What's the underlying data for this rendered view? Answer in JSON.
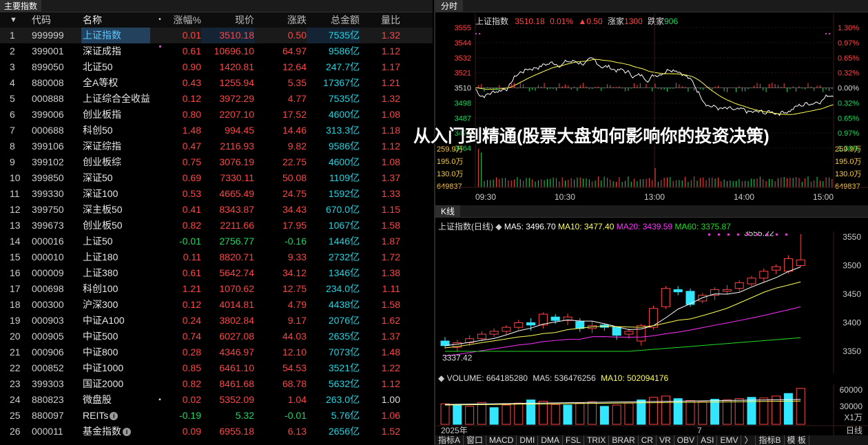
{
  "left": {
    "tab_label": "主要指数",
    "headers": {
      "code": "代码",
      "name": "名称",
      "dot": "•",
      "pct": "涨幅%",
      "price": "现价",
      "chg": "涨跌",
      "amount": "总金额",
      "vr": "量比"
    },
    "rows": [
      {
        "seq": "1",
        "code": "999999",
        "name": "上证指数",
        "pct": "0.01",
        "price": "3510.18",
        "chg": "0.50",
        "amt": "7535亿",
        "vr": "1.32",
        "dir": "up"
      },
      {
        "seq": "2",
        "code": "399001",
        "name": "深证成指",
        "pct": "0.61",
        "price": "10696.10",
        "chg": "64.97",
        "amt": "9586亿",
        "vr": "1.12",
        "dir": "up"
      },
      {
        "seq": "3",
        "code": "899050",
        "name": "北证50",
        "pct": "0.90",
        "price": "1420.81",
        "chg": "12.64",
        "amt": "247.7亿",
        "vr": "1.17",
        "dir": "up"
      },
      {
        "seq": "4",
        "code": "880008",
        "name": "全A等权",
        "pct": "0.43",
        "price": "1255.94",
        "chg": "5.35",
        "amt": "17367亿",
        "vr": "1.21",
        "dir": "up"
      },
      {
        "seq": "5",
        "code": "000888",
        "name": "上证综合全收益",
        "pct": "0.12",
        "price": "3972.29",
        "chg": "4.77",
        "amt": "7535亿",
        "vr": "1.32",
        "dir": "up"
      },
      {
        "seq": "6",
        "code": "399006",
        "name": "创业板指",
        "pct": "0.80",
        "price": "2207.10",
        "chg": "17.52",
        "amt": "4600亿",
        "vr": "1.08",
        "dir": "up"
      },
      {
        "seq": "7",
        "code": "000688",
        "name": "科创50",
        "pct": "1.48",
        "price": "994.45",
        "chg": "14.46",
        "amt": "313.3亿",
        "vr": "1.18",
        "dir": "up"
      },
      {
        "seq": "8",
        "code": "399106",
        "name": "深证综指",
        "pct": "0.47",
        "price": "2116.93",
        "chg": "9.82",
        "amt": "9586亿",
        "vr": "1.12",
        "dir": "up"
      },
      {
        "seq": "9",
        "code": "399102",
        "name": "创业板综",
        "pct": "0.75",
        "price": "3076.19",
        "chg": "22.75",
        "amt": "4600亿",
        "vr": "1.08",
        "dir": "up"
      },
      {
        "seq": "10",
        "code": "399850",
        "name": "深证50",
        "pct": "0.69",
        "price": "7330.11",
        "chg": "50.08",
        "amt": "1109亿",
        "vr": "1.37",
        "dir": "up"
      },
      {
        "seq": "11",
        "code": "399330",
        "name": "深证100",
        "pct": "0.53",
        "price": "4665.49",
        "chg": "24.75",
        "amt": "1592亿",
        "vr": "1.33",
        "dir": "up"
      },
      {
        "seq": "12",
        "code": "399750",
        "name": "深主板50",
        "pct": "0.41",
        "price": "8343.87",
        "chg": "34.43",
        "amt": "670.0亿",
        "vr": "1.15",
        "dir": "up"
      },
      {
        "seq": "13",
        "code": "399673",
        "name": "创业板50",
        "pct": "0.82",
        "price": "2211.66",
        "chg": "17.95",
        "amt": "1067亿",
        "vr": "1.58",
        "dir": "up"
      },
      {
        "seq": "14",
        "code": "000016",
        "name": "上证50",
        "pct": "-0.01",
        "price": "2756.77",
        "chg": "-0.16",
        "amt": "1446亿",
        "vr": "1.87",
        "dir": "dn"
      },
      {
        "seq": "15",
        "code": "000010",
        "name": "上证180",
        "pct": "0.11",
        "price": "8820.71",
        "chg": "9.33",
        "amt": "2732亿",
        "vr": "1.72",
        "dir": "up"
      },
      {
        "seq": "16",
        "code": "000009",
        "name": "上证380",
        "pct": "0.61",
        "price": "5642.74",
        "chg": "34.12",
        "amt": "1346亿",
        "vr": "1.38",
        "dir": "up"
      },
      {
        "seq": "17",
        "code": "000698",
        "name": "科创100",
        "pct": "1.21",
        "price": "1070.62",
        "chg": "12.75",
        "amt": "234.0亿",
        "vr": "1.11",
        "dir": "up"
      },
      {
        "seq": "18",
        "code": "000300",
        "name": "沪深300",
        "pct": "0.12",
        "price": "4014.81",
        "chg": "4.79",
        "amt": "4438亿",
        "vr": "1.58",
        "dir": "up"
      },
      {
        "seq": "19",
        "code": "000903",
        "name": "中证A100",
        "pct": "0.24",
        "price": "3802.84",
        "chg": "9.17",
        "amt": "2076亿",
        "vr": "1.62",
        "dir": "up"
      },
      {
        "seq": "20",
        "code": "000905",
        "name": "中证500",
        "pct": "0.74",
        "price": "6027.08",
        "chg": "44.03",
        "amt": "2635亿",
        "vr": "1.37",
        "dir": "up"
      },
      {
        "seq": "21",
        "code": "000906",
        "name": "中证800",
        "pct": "0.28",
        "price": "4346.97",
        "chg": "12.10",
        "amt": "7073亿",
        "vr": "1.48",
        "dir": "up"
      },
      {
        "seq": "22",
        "code": "000852",
        "name": "中证1000",
        "pct": "0.85",
        "price": "6461.10",
        "chg": "54.53",
        "amt": "3521亿",
        "vr": "1.22",
        "dir": "up"
      },
      {
        "seq": "23",
        "code": "399303",
        "name": "国证2000",
        "pct": "0.82",
        "price": "8461.68",
        "chg": "68.78",
        "amt": "5632亿",
        "vr": "1.12",
        "dir": "up"
      },
      {
        "seq": "24",
        "code": "880823",
        "name": "微盘股",
        "pct": "0.02",
        "price": "5352.09",
        "chg": "1.04",
        "amt": "263.0亿",
        "vr": "1.00",
        "dir": "up"
      },
      {
        "seq": "25",
        "code": "880097",
        "name": "REITs",
        "pct": "-0.19",
        "price": "5.32",
        "chg": "-0.01",
        "amt": "5.76亿",
        "vr": "1.06",
        "dir": "dn"
      },
      {
        "seq": "26",
        "code": "000011",
        "name": "基金指数",
        "pct": "0.09",
        "price": "6955.18",
        "chg": "6.13",
        "amt": "2656亿",
        "vr": "1.52",
        "dir": "up"
      }
    ]
  },
  "overlay_title": "从入门到精通(股票大盘如何影响你的投资决策)",
  "intraday": {
    "tab_label": "分时",
    "index_name": "上证指数",
    "price": "3510.18",
    "pct": "0.01%",
    "change": "▲0.50",
    "up_label": "涨家",
    "up_count": "1300",
    "down_label": "跌家",
    "down_count": "906",
    "price_axis": [
      "3555",
      "3544",
      "3532",
      "3521",
      "3510",
      "3498",
      "3487",
      "3476",
      "3464"
    ],
    "pct_axis": [
      "1.30%",
      "0.97%",
      "0.65%",
      "0.32%",
      "0.00%",
      "0.32%",
      "0.65%",
      "0.97%",
      "1.30%"
    ],
    "vol_axis_left": [
      "259.9万",
      "195.0万",
      "130.0万",
      "649837"
    ],
    "vol_axis_right": [
      "259.9万",
      "195.0万",
      "130.0万",
      "649837"
    ],
    "time_axis": [
      "09:30",
      "10:30",
      "13:00",
      "14:00",
      "15:00"
    ]
  },
  "kline": {
    "tab_label": "K线",
    "title": "上证指数(日线)",
    "ma5_label": "MA5: 3496.70",
    "ma10_label": "MA10: 3477.40",
    "ma20_label": "MA20: 3439.59",
    "ma60_label": "MA60: 3375.87",
    "price_axis": [
      "3550",
      "3500",
      "3450",
      "3400",
      "3350"
    ],
    "high_label": "3555.22",
    "low_label": "3337.42",
    "volume_label": "VOLUME: 664185280",
    "vol_ma5_label": "MA5: 536476256",
    "vol_ma10_label": "MA10: 502094176",
    "vol_axis": [
      "60000",
      "30000",
      "X1万"
    ],
    "date_left": "2025年",
    "date_mid": "7",
    "period": "日线"
  },
  "bottom_tabs": [
    "指标A",
    "窗口",
    "MACD",
    "DMI",
    "DMA",
    "FSL",
    "TRIX",
    "BRAR",
    "CR",
    "VR",
    "OBV",
    "ASI",
    "EMV",
    "〉",
    "指标B",
    "模 板"
  ],
  "colors": {
    "up": "#ff4545",
    "down": "#1ed760",
    "amount": "#22d4e0",
    "ma5": "#ffffff",
    "ma10": "#ffff55",
    "ma20": "#ff33ff",
    "ma60": "#22dd22"
  }
}
